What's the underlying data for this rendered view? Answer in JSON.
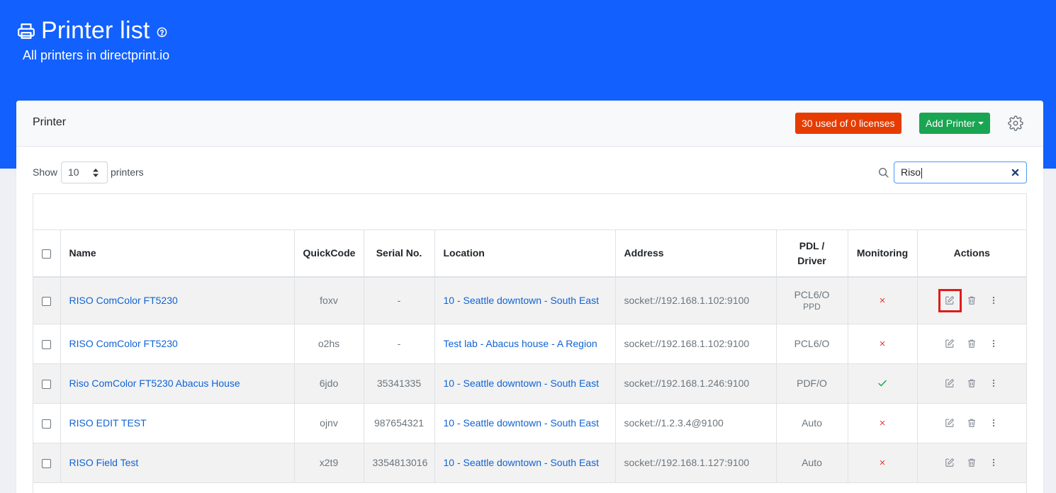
{
  "header": {
    "title": "Printer list",
    "subtitle": "All printers in directprint.io"
  },
  "card": {
    "title": "Printer",
    "license_badge": "30 used of 0 licenses",
    "add_button": "Add Printer"
  },
  "controls": {
    "show_label": "Show",
    "page_length": "10",
    "printers_label": "printers",
    "search_value": "Riso"
  },
  "columns": {
    "name": "Name",
    "quickcode": "QuickCode",
    "serial": "Serial No.",
    "location": "Location",
    "address": "Address",
    "pdl_line1": "PDL /",
    "pdl_line2": "Driver",
    "monitoring": "Monitoring",
    "actions": "Actions"
  },
  "rows": [
    {
      "name": "RISO ComColor FT5230",
      "quickcode": "foxv",
      "serial": "-",
      "location": "10 - Seattle downtown - South East",
      "address": "socket://192.168.1.102:9100",
      "pdl": "PCL6/O",
      "driver": "PPD",
      "monitoring": "×"
    },
    {
      "name": "RISO ComColor FT5230",
      "quickcode": "o2hs",
      "serial": "-",
      "location": "Test lab - Abacus house - A Region",
      "address": "socket://192.168.1.102:9100",
      "pdl": "PCL6/O",
      "driver": "",
      "monitoring": "×"
    },
    {
      "name": "Riso ComColor FT5230 Abacus House",
      "quickcode": "6jdo",
      "serial": "35341335",
      "location": "10 - Seattle downtown - South East",
      "address": "socket://192.168.1.246:9100",
      "pdl": "PDF/O",
      "driver": "",
      "monitoring": "✓"
    },
    {
      "name": "RISO EDIT TEST",
      "quickcode": "ojnv",
      "serial": "987654321",
      "location": "10 - Seattle downtown - South East",
      "address": "socket://1.2.3.4@9100",
      "pdl": "Auto",
      "driver": "",
      "monitoring": "×"
    },
    {
      "name": "RISO Field Test",
      "quickcode": "x2t9",
      "serial": "3354813016",
      "location": "10 - Seattle downtown - South East",
      "address": "socket://192.168.1.127:9100",
      "pdl": "Auto",
      "driver": "",
      "monitoring": "×"
    }
  ],
  "colors": {
    "header_bg": "#1260fe",
    "license_badge": "#e63c00",
    "add_button": "#1aa552",
    "link": "#1063d4",
    "monitor_off": "#e63c3c",
    "monitor_ok": "#1aa552"
  },
  "icons": {
    "title": "printer-icon",
    "help": "help-icon",
    "settings": "gear-icon",
    "search": "search-icon",
    "clear": "close-icon",
    "edit": "edit-icon",
    "delete": "trash-icon",
    "more": "more-vertical-icon"
  }
}
